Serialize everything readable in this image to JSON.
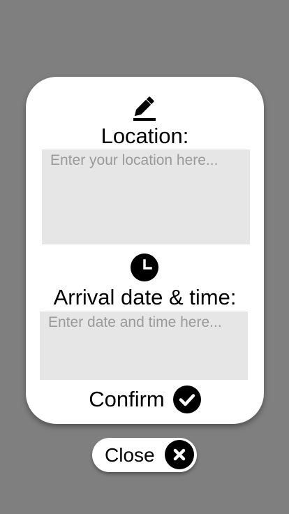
{
  "dialog": {
    "location": {
      "icon": "pencil-edit-icon",
      "label": "Location:",
      "placeholder": "Enter your location here..."
    },
    "arrival": {
      "icon": "clock-icon",
      "label": "Arrival date & time:",
      "placeholder": "Enter date and time here..."
    },
    "confirm": {
      "label": "Confirm",
      "icon": "check-circle-icon"
    }
  },
  "close": {
    "label": "Close",
    "icon": "close-circle-icon"
  },
  "colors": {
    "backdrop": "#7f7f7f",
    "card": "#ffffff",
    "field_bg": "#e6e6e6",
    "placeholder": "#9a9a9a",
    "icon": "#000000"
  }
}
